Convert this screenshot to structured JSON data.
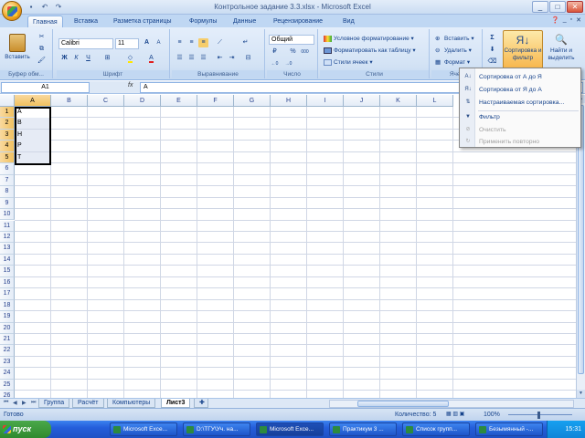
{
  "window": {
    "title": "Контрольное задание 3.3.xlsx - Microsoft Excel",
    "buttons": [
      "_",
      "□",
      "✕"
    ]
  },
  "quick_access": [
    "save",
    "undo",
    "redo"
  ],
  "tabs": [
    {
      "label": "Главная",
      "active": true
    },
    {
      "label": "Вставка"
    },
    {
      "label": "Разметка страницы"
    },
    {
      "label": "Формулы"
    },
    {
      "label": "Данные"
    },
    {
      "label": "Рецензирование"
    },
    {
      "label": "Вид"
    }
  ],
  "ribbon": {
    "clipboard": {
      "paste_label": "Вставить",
      "group_label": "Буфер обм..."
    },
    "font": {
      "name": "Calibri",
      "size": "11",
      "bold": "Ж",
      "italic": "К",
      "underline": "Ч",
      "grow": "A",
      "shrink": "A",
      "group_label": "Шрифт"
    },
    "alignment": {
      "group_label": "Выравнивание"
    },
    "number": {
      "format": "Общий",
      "percent": "%",
      "thousands": "000",
      "group_label": "Число"
    },
    "styles": {
      "conditional": "Условное форматирование",
      "as_table": "Форматировать как таблицу",
      "cell_styles": "Стили ячеек",
      "group_label": "Стили"
    },
    "cells": {
      "insert": "Вставить",
      "delete": "Удалить",
      "format": "Формат",
      "group_label": "Ячей"
    },
    "editing": {
      "sigma": "Σ",
      "sort_filter": "Сортировка и фильтр",
      "find_select": "Найти и выделить"
    }
  },
  "formula_bar": {
    "name_box": "A1",
    "fx": "fx",
    "value": "A"
  },
  "columns": [
    "A",
    "B",
    "C",
    "D",
    "E",
    "F",
    "G",
    "H",
    "I",
    "J",
    "K",
    "L"
  ],
  "rows": [
    "1",
    "2",
    "3",
    "4",
    "5",
    "6",
    "7",
    "8",
    "9",
    "10",
    "11",
    "12",
    "13",
    "14",
    "15",
    "16",
    "17",
    "18",
    "19",
    "20",
    "21",
    "22",
    "23",
    "24",
    "25",
    "26"
  ],
  "cells_A": [
    "A",
    "B",
    "H",
    "P",
    "T"
  ],
  "sheets": [
    {
      "label": "Группа"
    },
    {
      "label": "Расчёт"
    },
    {
      "label": "Компьютеры"
    },
    {
      "label": "Лист3",
      "active": true
    }
  ],
  "status": {
    "left": "Готово",
    "count": "Количество: 5",
    "zoom": "100%"
  },
  "sort_menu": {
    "items": [
      {
        "label": "Сортировка от А до Я",
        "icon": "sort-az-icon",
        "enabled": true
      },
      {
        "label": "Сортировка от Я до А",
        "icon": "sort-za-icon",
        "enabled": true
      },
      {
        "label": "Настраиваемая сортировка...",
        "icon": "custom-sort-icon",
        "enabled": true
      },
      {
        "label": "Фильтр",
        "icon": "filter-icon",
        "enabled": true
      },
      {
        "label": "Очистить",
        "icon": "clear-filter-icon",
        "enabled": false
      },
      {
        "label": "Применить повторно",
        "icon": "reapply-icon",
        "enabled": false
      }
    ]
  },
  "taskbar": {
    "start": "пуск",
    "tasks": [
      {
        "label": "Microsoft Exce..."
      },
      {
        "label": "D:\\ТГУ\\Уч. на..."
      },
      {
        "label": "Microsoft Exce...",
        "active": true
      },
      {
        "label": "Практикум 3 ..."
      },
      {
        "label": "Список групп..."
      },
      {
        "label": "Безымянный -..."
      }
    ],
    "time": "15:31"
  }
}
